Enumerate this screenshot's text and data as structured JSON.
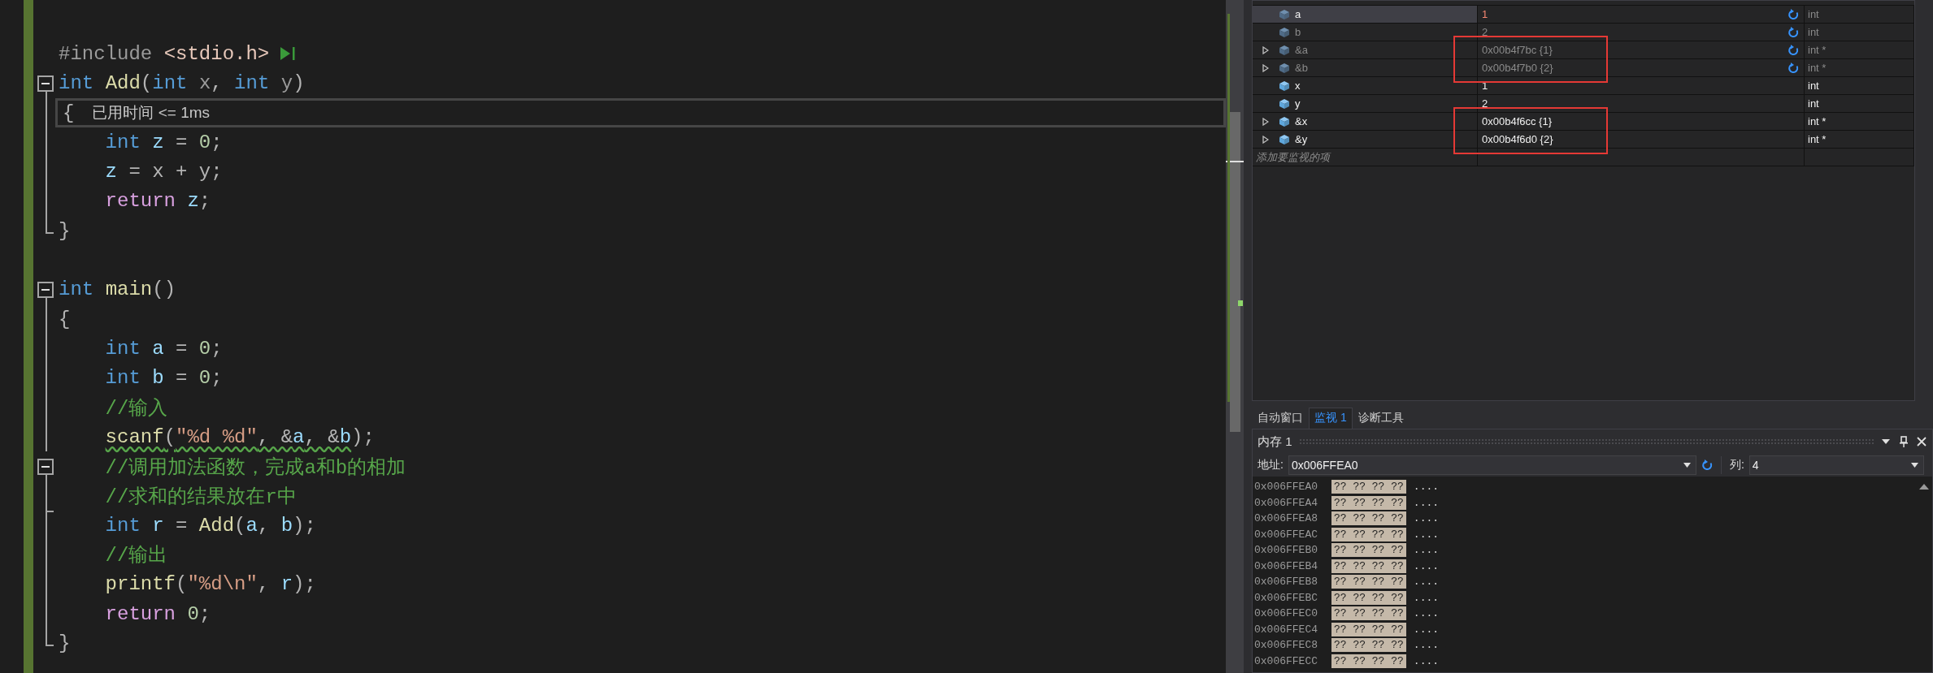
{
  "editor": {
    "lines": [
      {
        "current": false
      },
      {
        "current": false,
        "run_to_click": true,
        "tokens": [
          {
            "t": "#include ",
            "kind": "pre"
          },
          {
            "t": "<stdio.h>",
            "kind": "inc"
          }
        ]
      },
      {
        "current": false,
        "fold": {
          "expanded": true
        },
        "tokens": [
          {
            "t": "int",
            "kind": "kw"
          },
          {
            "t": " Add",
            "kind": "fn"
          },
          {
            "t": "(",
            "kind": "punc"
          },
          {
            "t": "int",
            "kind": "kw"
          },
          {
            "t": " x",
            "kind": "param"
          },
          {
            "t": ", ",
            "kind": "punc"
          },
          {
            "t": "int",
            "kind": "kw"
          },
          {
            "t": " y",
            "kind": "param"
          },
          {
            "t": ")",
            "kind": "punc"
          }
        ]
      },
      {
        "current": true,
        "guide": {
          "kind": "line"
        },
        "perf_tip": "已用时间 <= 1ms",
        "tokens": [
          {
            "t": "{",
            "kind": "punc"
          }
        ]
      },
      {
        "current": false,
        "guide": {
          "kind": "line"
        },
        "tokens": [
          {
            "t": "    int",
            "kind": "kw"
          },
          {
            "t": " z",
            "kind": "local"
          },
          {
            "t": " = ",
            "kind": "punc"
          },
          {
            "t": "0",
            "kind": "num"
          },
          {
            "t": ";",
            "kind": "punc"
          }
        ]
      },
      {
        "current": false,
        "guide": {
          "kind": "line"
        },
        "tokens": [
          {
            "t": "    z",
            "kind": "local"
          },
          {
            "t": " = x + y;",
            "kind": "punc"
          }
        ]
      },
      {
        "current": false,
        "guide": {
          "kind": "line"
        },
        "tokens": [
          {
            "t": "    return",
            "kind": "ctl"
          },
          {
            "t": " z",
            "kind": "local"
          },
          {
            "t": ";",
            "kind": "punc"
          }
        ]
      },
      {
        "current": false,
        "guide": {
          "kind": "end"
        },
        "tokens": [
          {
            "t": "}",
            "kind": "punc"
          }
        ]
      },
      {
        "current": false
      },
      {
        "current": false,
        "fold": {
          "expanded": true
        },
        "tokens": [
          {
            "t": "int",
            "kind": "kw"
          },
          {
            "t": " main",
            "kind": "fn"
          },
          {
            "t": "()",
            "kind": "punc"
          }
        ]
      },
      {
        "current": false,
        "guide": {
          "kind": "line"
        },
        "tokens": [
          {
            "t": "{",
            "kind": "punc"
          }
        ]
      },
      {
        "current": false,
        "guide": {
          "kind": "line"
        },
        "tokens": [
          {
            "t": "    int",
            "kind": "kw"
          },
          {
            "t": " a",
            "kind": "local"
          },
          {
            "t": " = ",
            "kind": "punc"
          },
          {
            "t": "0",
            "kind": "num"
          },
          {
            "t": ";",
            "kind": "punc"
          }
        ]
      },
      {
        "current": false,
        "guide": {
          "kind": "line"
        },
        "tokens": [
          {
            "t": "    int",
            "kind": "kw"
          },
          {
            "t": " b",
            "kind": "local"
          },
          {
            "t": " = ",
            "kind": "punc"
          },
          {
            "t": "0",
            "kind": "num"
          },
          {
            "t": ";",
            "kind": "punc"
          }
        ]
      },
      {
        "current": false,
        "guide": {
          "kind": "line"
        },
        "tokens": [
          {
            "t": "    //输入",
            "kind": "cmt"
          }
        ]
      },
      {
        "current": false,
        "guide": {
          "kind": "line"
        },
        "tokens": [
          {
            "t": "    scanf",
            "kind": "fn",
            "warn": true
          },
          {
            "t": "(",
            "kind": "punc",
            "warn": true
          },
          {
            "t": "\"%d %d\"",
            "kind": "str",
            "warn": true
          },
          {
            "t": ", &",
            "kind": "punc",
            "warn": true
          },
          {
            "t": "a",
            "kind": "local",
            "warn": true
          },
          {
            "t": ", &",
            "kind": "punc",
            "warn": true
          },
          {
            "t": "b",
            "kind": "local",
            "warn": true
          },
          {
            "t": ");",
            "kind": "punc",
            "warn": false
          }
        ]
      },
      {
        "current": false,
        "fold": {
          "expanded": true
        },
        "tokens": [
          {
            "t": "    //调用加法函数，完成a和b的相加",
            "kind": "cmt"
          }
        ]
      },
      {
        "current": false,
        "guide": {
          "kind": "tick"
        },
        "tokens": [
          {
            "t": "    //求和的结果放在r中",
            "kind": "cmt"
          }
        ]
      },
      {
        "current": false,
        "guide": {
          "kind": "line"
        },
        "tokens": [
          {
            "t": "    int",
            "kind": "kw"
          },
          {
            "t": " r",
            "kind": "local"
          },
          {
            "t": " = ",
            "kind": "punc"
          },
          {
            "t": "Add",
            "kind": "fn"
          },
          {
            "t": "(",
            "kind": "punc"
          },
          {
            "t": "a",
            "kind": "local"
          },
          {
            "t": ", ",
            "kind": "punc"
          },
          {
            "t": "b",
            "kind": "local"
          },
          {
            "t": ");",
            "kind": "punc"
          }
        ]
      },
      {
        "current": false,
        "guide": {
          "kind": "line"
        },
        "tokens": [
          {
            "t": "    //输出",
            "kind": "cmt"
          }
        ]
      },
      {
        "current": false,
        "guide": {
          "kind": "line"
        },
        "tokens": [
          {
            "t": "    printf",
            "kind": "fn"
          },
          {
            "t": "(",
            "kind": "punc"
          },
          {
            "t": "\"%d\\n\"",
            "kind": "str"
          },
          {
            "t": ", ",
            "kind": "punc"
          },
          {
            "t": "r",
            "kind": "local"
          },
          {
            "t": ");",
            "kind": "punc"
          }
        ]
      },
      {
        "current": false,
        "guide": {
          "kind": "line"
        },
        "tokens": [
          {
            "t": "    return",
            "kind": "ctl"
          },
          {
            "t": " 0",
            "kind": "num"
          },
          {
            "t": ";",
            "kind": "punc"
          }
        ]
      },
      {
        "current": false,
        "guide": {
          "kind": "end"
        },
        "tokens": [
          {
            "t": "}",
            "kind": "punc"
          }
        ]
      }
    ]
  },
  "watch": {
    "rows": [
      {
        "name": "a",
        "value": "1",
        "type": "int",
        "selected": true,
        "stale": true,
        "changed": true,
        "expandable": false,
        "boxed": false
      },
      {
        "name": "b",
        "value": "2",
        "type": "int",
        "selected": false,
        "stale": true,
        "changed": false,
        "expandable": false,
        "boxed": false
      },
      {
        "name": "&a",
        "value": "0x00b4f7bc {1}",
        "type": "int *",
        "selected": false,
        "stale": true,
        "changed": false,
        "expandable": true,
        "boxed": true
      },
      {
        "name": "&b",
        "value": "0x00b4f7b0 {2}",
        "type": "int *",
        "selected": false,
        "stale": true,
        "changed": false,
        "expandable": true,
        "boxed": true
      },
      {
        "name": "x",
        "value": "1",
        "type": "int",
        "selected": false,
        "stale": false,
        "changed": false,
        "expandable": false,
        "boxed": false
      },
      {
        "name": "y",
        "value": "2",
        "type": "int",
        "selected": false,
        "stale": false,
        "changed": false,
        "expandable": false,
        "boxed": false
      },
      {
        "name": "&x",
        "value": "0x00b4f6cc {1}",
        "type": "int *",
        "selected": false,
        "stale": false,
        "changed": false,
        "expandable": true,
        "boxed": true
      },
      {
        "name": "&y",
        "value": "0x00b4f6d0 {2}",
        "type": "int *",
        "selected": false,
        "stale": false,
        "changed": false,
        "expandable": true,
        "boxed": true
      }
    ],
    "add_placeholder": "添加要监视的项"
  },
  "tool_tabs": [
    {
      "label": "自动窗口",
      "selected": false
    },
    {
      "label": "监视 1",
      "selected": true
    },
    {
      "label": "诊断工具",
      "selected": false
    }
  ],
  "memory": {
    "title": "内存 1",
    "address_label": "地址:",
    "address": "0x006FFEA0",
    "columns_label": "列:",
    "columns": "4",
    "rows": [
      {
        "address": "0x006FFEA0",
        "bytes": "?? ?? ?? ??",
        "ascii": "...."
      },
      {
        "address": "0x006FFEA4",
        "bytes": "?? ?? ?? ??",
        "ascii": "...."
      },
      {
        "address": "0x006FFEA8",
        "bytes": "?? ?? ?? ??",
        "ascii": "...."
      },
      {
        "address": "0x006FFEAC",
        "bytes": "?? ?? ?? ??",
        "ascii": "...."
      },
      {
        "address": "0x006FFEB0",
        "bytes": "?? ?? ?? ??",
        "ascii": "...."
      },
      {
        "address": "0x006FFEB4",
        "bytes": "?? ?? ?? ??",
        "ascii": "...."
      },
      {
        "address": "0x006FFEB8",
        "bytes": "?? ?? ?? ??",
        "ascii": "...."
      },
      {
        "address": "0x006FFEBC",
        "bytes": "?? ?? ?? ??",
        "ascii": "...."
      },
      {
        "address": "0x006FFEC0",
        "bytes": "?? ?? ?? ??",
        "ascii": "...."
      },
      {
        "address": "0x006FFEC4",
        "bytes": "?? ?? ?? ??",
        "ascii": "...."
      },
      {
        "address": "0x006FFEC8",
        "bytes": "?? ?? ?? ??",
        "ascii": "...."
      },
      {
        "address": "0x006FFECC",
        "bytes": "?? ?? ?? ??",
        "ascii": "...."
      }
    ]
  }
}
